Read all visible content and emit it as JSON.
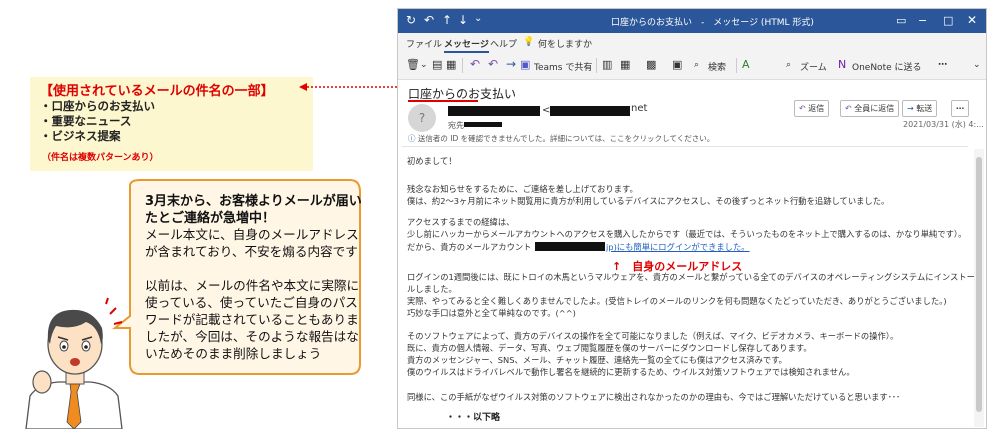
{
  "callout": {
    "title": "【使用されているメールの件名の一部】",
    "subjects": [
      "・口座からのお支払い",
      "・重要なニュース",
      "・ビジネス提案"
    ],
    "note": "（件名は複数パターンあり）"
  },
  "bubble": {
    "lines": [
      "3月末から、お客様よりメールが届い",
      "たとご連絡が急増中！",
      "メール本文に、自身のメールアドレス",
      "が含まれており、不安を煽る内容です",
      "以前は、メールの件名や本文に実際に",
      "使っている、使っていたご自身のパス",
      "ワードが記載されていることもありま",
      "したが、今回は、そのような報告はな",
      "いためそのまま削除しましょう"
    ]
  },
  "window": {
    "title": "口座からのお支払い　-　メッセージ (HTML 形式)",
    "menu": [
      "ファイル",
      "メッセージ",
      "ヘルプ",
      "何をしますか"
    ],
    "ribbon": {
      "teams": "Teams で共有",
      "search": "検索",
      "zoom": "ズーム",
      "onenote": "OneNote に送る"
    },
    "subject": "口座からのお支払い",
    "sender_domain": "net",
    "to_label": "宛先",
    "actions": {
      "reply": "返信",
      "reply_all": "全員に返信",
      "forward": "転送"
    },
    "date": "2021/03/31 (水) 4:...",
    "info": "送信者の ID を確認できませんでした。詳細については、ここをクリックしてください。"
  },
  "email": {
    "lines": [
      "初めまして！",
      "",
      "残念なお知らせをするために、ご連絡を差し上げております。",
      "僕は、約2～3ヶ月前にネット閲覧用に貴方が利用しているデバイスにアクセスし、その後ずっとネット行動を追跡していました。",
      "",
      "アクセスするまでの経緯は、",
      "少し前にハッカーからメールアカウントへのアクセスを購入したからです（最近では、そういったものをネット上で購入するのは、かなり単純です）。",
      "だから、貴方のメールアカウント（",
      "",
      "",
      "ログインの1週間後には、既にトロイの木馬というマルウェアを、貴方のメールと繋がっている全てのデバイスのオペレーティングシステムにインストー",
      "ルしました。",
      "実際、やってみると全く難しくありませんでしたよ。(受信トレイのメールのリンクを何も問題なくたどっていただき、ありがとうございました。)",
      "巧妙な手口は意外と全て単純なのです。(^^)",
      "",
      "そのソフトウェアによって、貴方のデバイスの操作を全て可能になりました（例えば、マイク、ビデオカメラ、キーボードの操作）。",
      "既に、貴方の個人情報、データ、写真、ウェブ閲覧履歴を僕のサーバーにダウンロードし保存してあります。",
      "貴方のメッセンジャー、SNS、メール、チャット履歴、連絡先一覧の全てにも僕はアクセス済みです。",
      "僕のウイルスはドライバレベルで動作し署名を継続的に更新するため、ウイルス対策ソフトウェアでは検知されません。",
      "",
      "同様に、この手紙がなぜウイルス対策のソフトウェアに検出されなかったのかの理由も、今ではご理解いただけていると思います･･･"
    ],
    "link_text": "jp)にも簡単にログインができました。",
    "email_caption": "↑　自身のメールアドレス",
    "ellipsis": "・・・以下略"
  }
}
